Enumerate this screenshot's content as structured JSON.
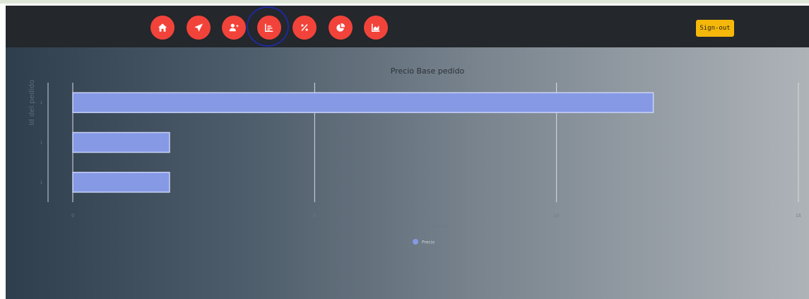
{
  "nav": {
    "buttons": [
      {
        "icon": "home-icon",
        "label": "Home"
      },
      {
        "icon": "paper-plane-icon",
        "label": "Send"
      },
      {
        "icon": "add-user-icon",
        "label": "Add user"
      },
      {
        "icon": "line-chart-icon",
        "label": "Chart",
        "active": true
      },
      {
        "icon": "percent-icon",
        "label": "Percent"
      },
      {
        "icon": "pie-chart-icon",
        "label": "Pie chart"
      },
      {
        "icon": "area-chart-icon",
        "label": "Area chart"
      }
    ],
    "signout_label": "Sign-out"
  },
  "colors": {
    "navbar": "#24272b",
    "nav_button": "#f2433a",
    "active_ring": "#1f2a9c",
    "signout": "#f5b70a",
    "bar_fill": "#8599e5",
    "bar_border": "#c9d2f7"
  },
  "chart_data": {
    "type": "bar",
    "orientation": "horizontal",
    "title": "Precio Base pedido",
    "xlabel": "Values",
    "ylabel": "Id del pedido",
    "categories": [
      "1",
      "1",
      "1"
    ],
    "series": [
      {
        "name": "Precio",
        "values": [
          12,
          2,
          2
        ]
      }
    ],
    "xlim": [
      0,
      15
    ],
    "xticks": [
      "0",
      "5",
      "10",
      "15"
    ],
    "grid": "vertical",
    "legend": "bottom-center"
  }
}
